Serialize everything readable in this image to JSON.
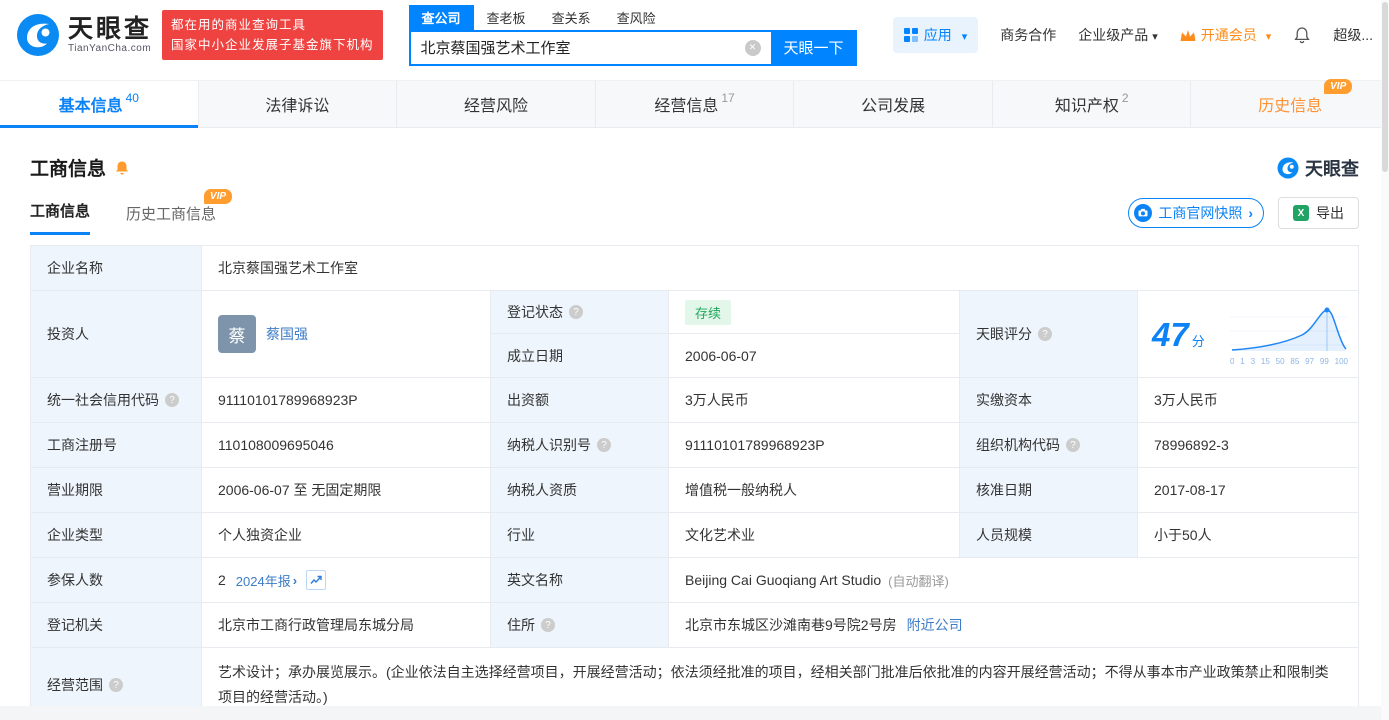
{
  "colors": {
    "primary": "#0084ff",
    "link": "#3d7cc9",
    "vip_orange": "#ff9234",
    "status_green": "#1fa75d",
    "promo_red": "#ee4340"
  },
  "brand": {
    "name": "天眼查",
    "domain": "TianYanCha.com"
  },
  "header": {
    "promo_line1": "都在用的商业查询工具",
    "promo_line2": "国家中小企业发展子基金旗下机构",
    "search_tabs": [
      {
        "label": "查公司"
      },
      {
        "label": "查老板"
      },
      {
        "label": "查关系"
      },
      {
        "label": "查风险"
      }
    ],
    "search_value": "北京蔡国强艺术工作室",
    "search_button": "天眼一下",
    "nav_apps": "应用",
    "nav_coop": "商务合作",
    "nav_enterprise": "企业级产品",
    "nav_vip": "开通会员",
    "nav_more": "超级..."
  },
  "section_tabs": [
    {
      "label": "基本信息",
      "count": "40"
    },
    {
      "label": "法律诉讼",
      "count": ""
    },
    {
      "label": "经营风险",
      "count": ""
    },
    {
      "label": "经营信息",
      "count": "17"
    },
    {
      "label": "公司发展",
      "count": ""
    },
    {
      "label": "知识产权",
      "count": "2"
    },
    {
      "label": "历史信息",
      "count": "",
      "vip": "VIP"
    }
  ],
  "main": {
    "title": "工商信息",
    "subtab_current": "工商信息",
    "subtab_history": "历史工商信息",
    "vip_label": "VIP",
    "snapshot_button": "工商官网快照",
    "export_button": "导出"
  },
  "fields": {
    "company_name": {
      "label": "企业名称",
      "value": "北京蔡国强艺术工作室"
    },
    "investor": {
      "label": "投资人",
      "avatar": "蔡",
      "name": "蔡国强"
    },
    "reg_status": {
      "label": "登记状态",
      "value": "存续"
    },
    "establish_date": {
      "label": "成立日期",
      "value": "2006-06-07"
    },
    "score": {
      "label": "天眼评分",
      "value": "47",
      "unit": "分",
      "ticks": [
        "0",
        "1",
        "3",
        "15",
        "50",
        "85",
        "97",
        "99",
        "100"
      ]
    },
    "credit_code": {
      "label": "统一社会信用代码",
      "value": "91110101789968923P"
    },
    "capital": {
      "label": "出资额",
      "value": "3万人民币"
    },
    "paid_capital": {
      "label": "实缴资本",
      "value": "3万人民币"
    },
    "reg_number": {
      "label": "工商注册号",
      "value": "110108009695046"
    },
    "taxpayer_id": {
      "label": "纳税人识别号",
      "value": "91110101789968923P"
    },
    "org_code": {
      "label": "组织机构代码",
      "value": "78996892-3"
    },
    "business_term": {
      "label": "营业期限",
      "value": "2006-06-07 至 无固定期限"
    },
    "taxpayer_quality": {
      "label": "纳税人资质",
      "value": "增值税一般纳税人"
    },
    "approval_date": {
      "label": "核准日期",
      "value": "2017-08-17"
    },
    "company_type": {
      "label": "企业类型",
      "value": "个人独资企业"
    },
    "industry": {
      "label": "行业",
      "value": "文化艺术业"
    },
    "staff_size": {
      "label": "人员规模",
      "value": "小于50人"
    },
    "insured": {
      "label": "参保人数",
      "value": "2",
      "report": "2024年报"
    },
    "english_name": {
      "label": "英文名称",
      "value": "Beijing Cai Guoqiang Art Studio",
      "note": "(自动翻译)"
    },
    "reg_authority": {
      "label": "登记机关",
      "value": "北京市工商行政管理局东城分局"
    },
    "address": {
      "label": "住所",
      "value": "北京市东城区沙滩南巷9号院2号房",
      "nearby": "附近公司"
    },
    "business_scope": {
      "label": "经营范围",
      "value": "艺术设计；承办展览展示。(企业依法自主选择经营项目，开展经营活动；依法须经批准的项目，经相关部门批准后依批准的内容开展经营活动；不得从事本市产业政策禁止和限制类项目的经营活动。)"
    }
  }
}
